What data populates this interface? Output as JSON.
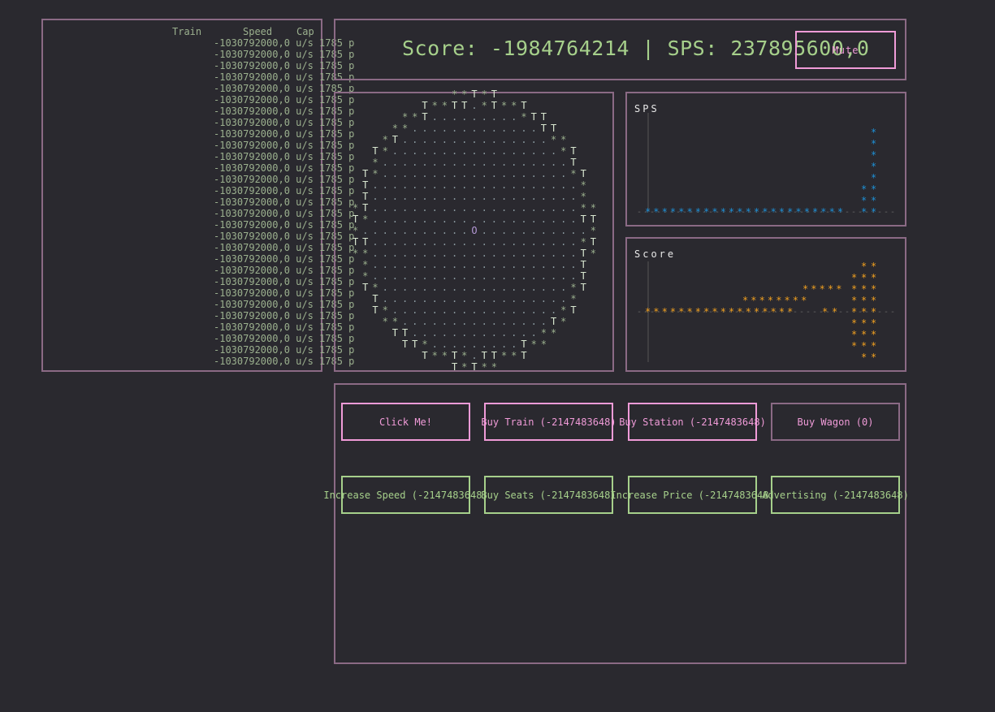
{
  "header": {
    "score_text": "Score: -1984764214 | SPS: 237895600,0",
    "mute_label": "Mute"
  },
  "train_list": {
    "headers": {
      "train": "Train",
      "speed": "Speed",
      "cap": "Cap"
    },
    "row_text": "-1030792000,0 u/s 1785 p",
    "row_count": 29
  },
  "track": {
    "center_glyph": "O"
  },
  "graphs": {
    "sps_title": "SPS",
    "score_title": "Score"
  },
  "controls": {
    "click": "Click Me!",
    "buy_train": "Buy Train (-2147483648)",
    "buy_station": "Buy Station (-2147483648)",
    "buy_wagon": "Buy Wagon (0)",
    "increase_speed": "Increase Speed (-2147483648)",
    "buy_seats": "Buy Seats (-2147483648)",
    "increase_price": "Increase Price (-2147483648)",
    "advertising": "Advertising (-2147483648)"
  },
  "colors": {
    "background": "#2a292f",
    "border": "#8b6a85",
    "accent_pink": "#f09bd8",
    "accent_green": "#a6d08b",
    "sps_plot": "#1e90d6",
    "score_plot": "#f0a020"
  }
}
